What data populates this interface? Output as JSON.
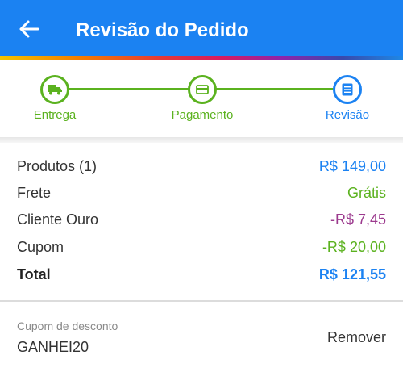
{
  "header": {
    "title": "Revisão do Pedido",
    "back_icon": "arrow-left-icon",
    "background": "#1b82f2"
  },
  "stepper": {
    "steps": [
      {
        "label": "Entrega",
        "icon": "truck-icon",
        "state": "done"
      },
      {
        "label": "Pagamento",
        "icon": "credit-card-icon",
        "state": "done"
      },
      {
        "label": "Revisão",
        "icon": "document-icon",
        "state": "current"
      }
    ],
    "done_color": "#5bb21f",
    "current_color": "#1b82f2"
  },
  "summary": {
    "rows": [
      {
        "label": "Produtos (1)",
        "value": "R$ 149,00"
      },
      {
        "label": "Frete",
        "value": "Grátis"
      },
      {
        "label": "Cliente Ouro",
        "value": "-R$ 7,45"
      },
      {
        "label": "Cupom",
        "value": "-R$ 20,00"
      }
    ],
    "total": {
      "label": "Total",
      "value": "R$ 121,55"
    }
  },
  "coupon": {
    "caption": "Cupom de desconto",
    "code": "GANHEI20",
    "remove_label": "Remover"
  }
}
